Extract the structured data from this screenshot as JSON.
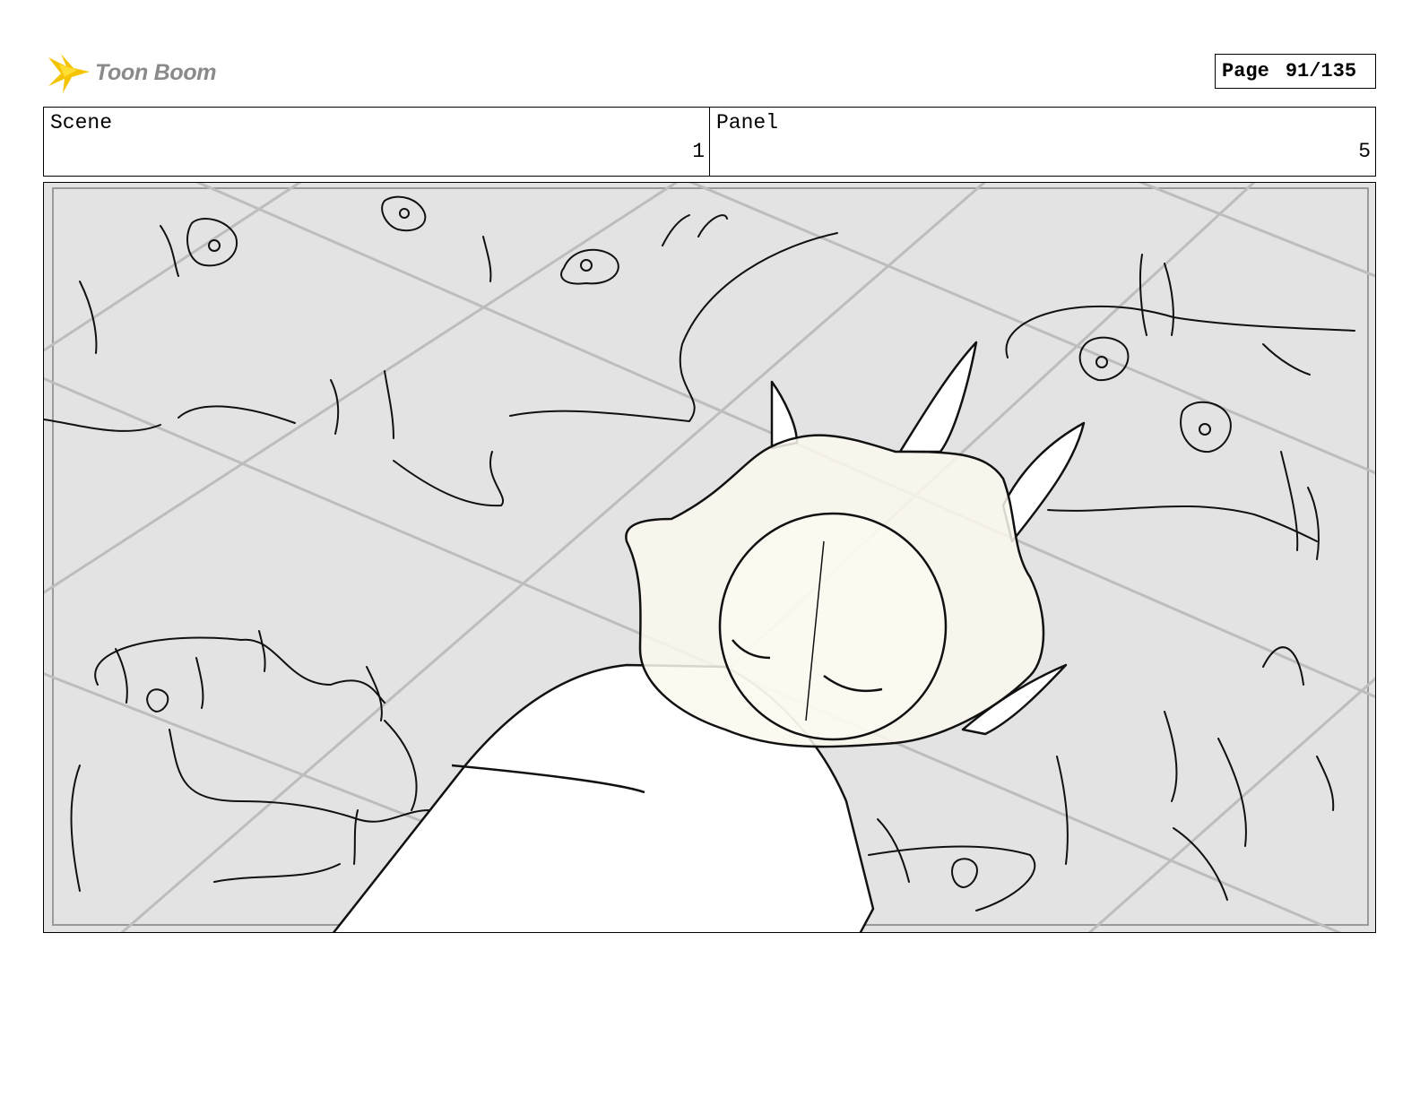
{
  "logo": {
    "text": "Toon Boom",
    "icon": "toon-boom-star-icon",
    "accent": "#f5c400"
  },
  "page": {
    "label": "Page",
    "number": "91/135"
  },
  "scene": {
    "label": "Scene",
    "value": "1"
  },
  "panel": {
    "label": "Panel",
    "value": "5"
  },
  "colors": {
    "background": "#e3e3e3",
    "lines": "#111111",
    "tiles": "#bdbdbd",
    "veil": "#fbf8ee"
  }
}
